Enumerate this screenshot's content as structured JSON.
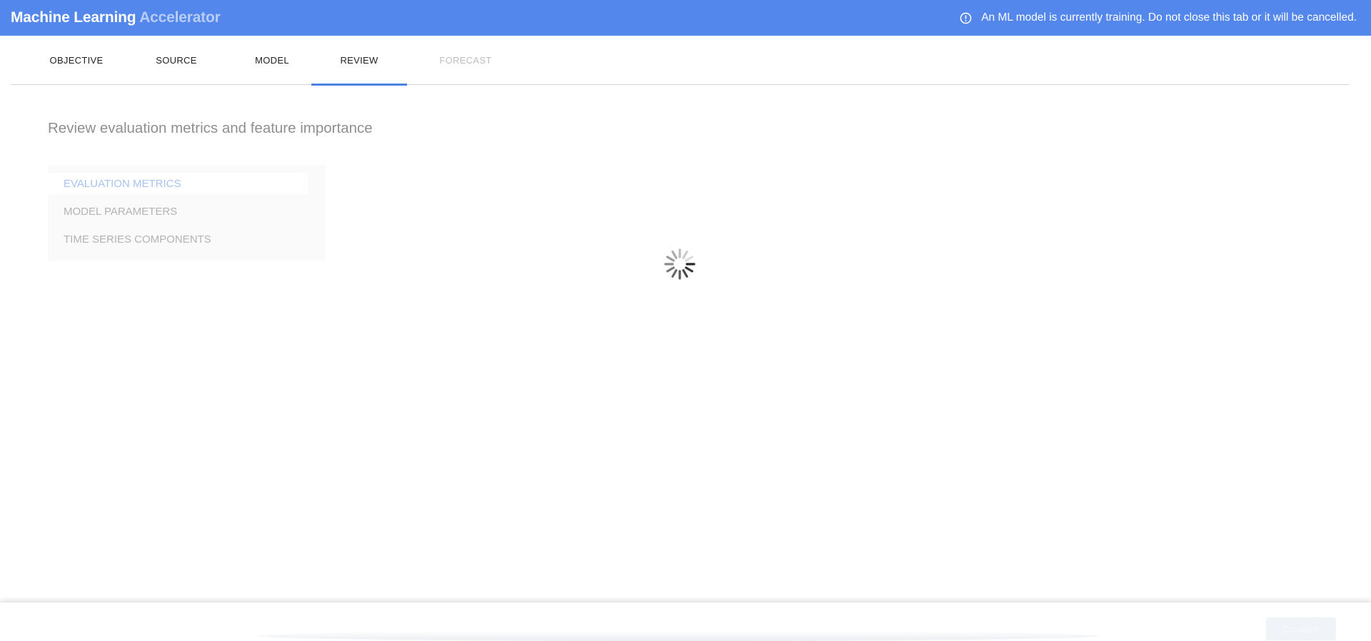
{
  "app": {
    "title_primary": "Machine Learning",
    "title_secondary": "Accelerator"
  },
  "notice": {
    "icon": "exclamation-circle-icon",
    "text": "An ML model is currently training. Do not close this tab or it will be cancelled."
  },
  "tabs": [
    {
      "label": "OBJECTIVE",
      "state": "normal"
    },
    {
      "label": "SOURCE",
      "state": "normal"
    },
    {
      "label": "MODEL",
      "state": "normal"
    },
    {
      "label": "REVIEW",
      "state": "active"
    },
    {
      "label": "FORECAST",
      "state": "disabled"
    }
  ],
  "review": {
    "title": "Review evaluation metrics and feature importance",
    "menu": [
      {
        "label": "EVALUATION METRICS",
        "active": true
      },
      {
        "label": "MODEL PARAMETERS",
        "active": false
      },
      {
        "label": "TIME SERIES COMPONENTS",
        "active": false
      }
    ]
  },
  "loading": {
    "icon": "loading-spinner-icon"
  },
  "footer": {
    "continue_label": "Continue"
  },
  "colors": {
    "app_bar": "#5487ec",
    "tab_indicator": "#4d82e2",
    "active_menu_text": "#a8c3ef"
  }
}
